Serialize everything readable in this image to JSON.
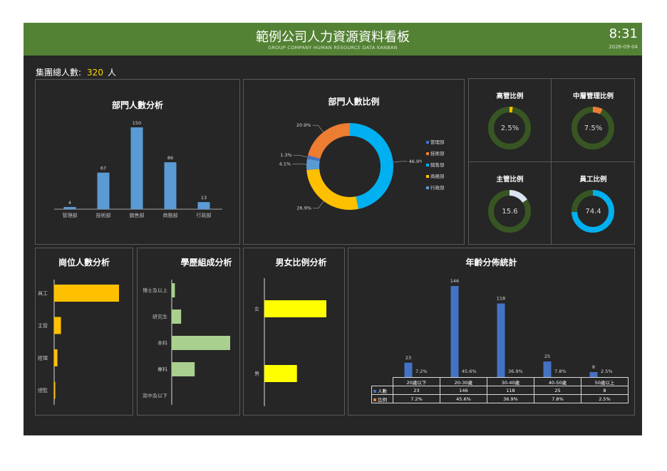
{
  "header": {
    "title": "範例公司人力資源資料看板",
    "subtitle": "GROUP COMPANY HUMAN RESOURCE DATA KANBAN",
    "time": "8:31",
    "date": "2026-09-04"
  },
  "summary": {
    "label": "集團總人數:",
    "value": "320",
    "unit": "人"
  },
  "colors": {
    "background": "#262626",
    "header": "#548235",
    "bar_blue": "#5b9bd5",
    "gold": "#ffc000",
    "green_light": "#a9d08e",
    "yellow": "#ffff00",
    "age_blue": "#4472c4",
    "ring_green": "#375623"
  },
  "chart_data": [
    {
      "type": "bar",
      "title": "部門人數分析",
      "categories": [
        "管理部",
        "技術部",
        "銷售部",
        "商務部",
        "行政部"
      ],
      "values": [
        4,
        67,
        150,
        86,
        13
      ]
    },
    {
      "type": "pie",
      "title": "部門人數比例",
      "labels": [
        "管理部",
        "技術部",
        "銷售部",
        "商務部",
        "行政部"
      ],
      "values": [
        1.3,
        20.9,
        46.9,
        26.9,
        4.1
      ],
      "value_labels": [
        "1.3%",
        "20.9%",
        "46.9%",
        "26.9%",
        "4.1%"
      ],
      "colors": [
        "#4472c4",
        "#ed7d31",
        "#00b0f0",
        "#ffc000",
        "#5b9bd5"
      ],
      "legend": "right"
    },
    {
      "type": "pie",
      "title": "高管比例",
      "value": 2.5,
      "label": "2.5%",
      "color": "#ffc000"
    },
    {
      "type": "pie",
      "title": "中層管理比例",
      "value": 7.5,
      "label": "7.5%",
      "color": "#ed7d31"
    },
    {
      "type": "pie",
      "title": "主管比例",
      "value": 15.6,
      "label": "15.6",
      "color": "#dae3f3"
    },
    {
      "type": "pie",
      "title": "員工比例",
      "value": 74.4,
      "label": "74.4",
      "color": "#00b0f0"
    },
    {
      "type": "bar",
      "orientation": "horizontal",
      "title": "崗位人數分析",
      "categories": [
        "員工",
        "主管",
        "經理",
        "總監"
      ],
      "values": [
        238,
        25,
        12,
        4
      ]
    },
    {
      "type": "bar",
      "orientation": "horizontal",
      "title": "學歷組成分析",
      "categories": [
        "博士及以上",
        "研究生",
        "本科",
        "專科",
        "高中及以下"
      ],
      "values": [
        3,
        9,
        56,
        22,
        0
      ]
    },
    {
      "type": "bar",
      "orientation": "horizontal",
      "title": "男女比例分析",
      "categories": [
        "女",
        "男"
      ],
      "values": [
        59,
        31
      ]
    },
    {
      "type": "bar",
      "title": "年齡分佈統計",
      "categories": [
        "20歲以下",
        "20-30歲",
        "30-40歲",
        "40-50歲",
        "50歲以上"
      ],
      "series": [
        {
          "name": "人數",
          "values": [
            23,
            146,
            118,
            25,
            8
          ]
        },
        {
          "name": "比例",
          "values": [
            7.2,
            45.6,
            36.9,
            7.8,
            2.5
          ]
        }
      ],
      "percent_labels": [
        "7.2%",
        "45.6%",
        "36.9%",
        "7.8%",
        "2.5%"
      ],
      "table": {
        "row_headers": [
          "人數",
          "比例"
        ],
        "rows": [
          [
            "23",
            "146",
            "118",
            "25",
            "8"
          ],
          [
            "7.2%",
            "45.6%",
            "36.9%",
            "7.8%",
            "2.5%"
          ]
        ]
      }
    }
  ]
}
